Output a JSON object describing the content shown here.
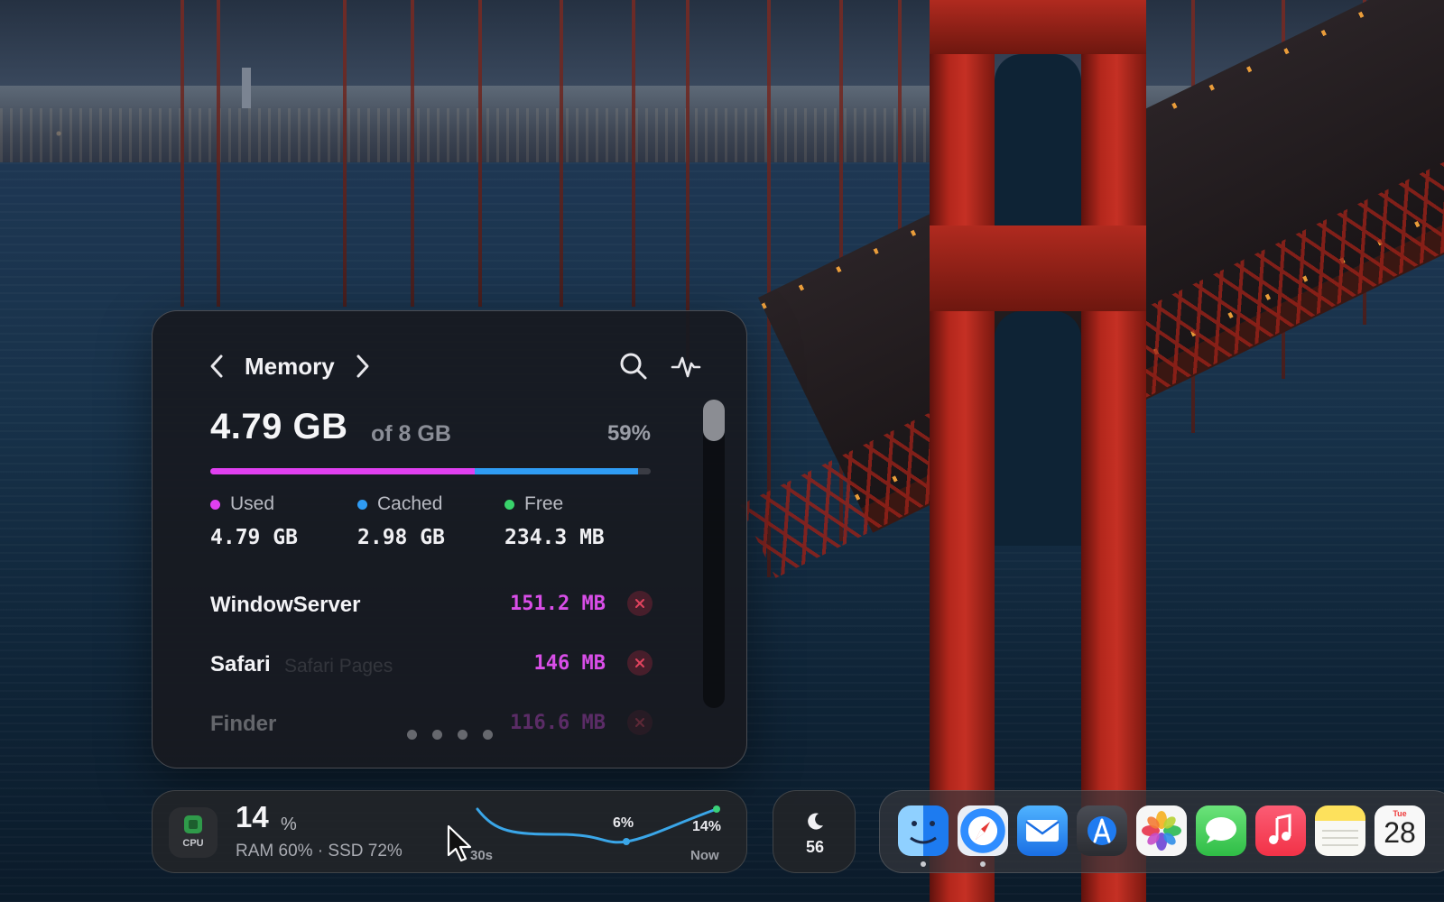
{
  "memory_widget": {
    "title": "Memory",
    "used_value": "4.79 GB",
    "total_text": "of 8 GB",
    "percent": "59%",
    "usage_bar": {
      "used_fraction": 0.6,
      "cached_fraction": 0.37,
      "used_color": "#e040f0",
      "cached_color": "#2f9cf4",
      "track_color": "#3a3c44"
    },
    "legend": [
      {
        "label": "Used",
        "value": "4.79 GB",
        "color": "#e040f0"
      },
      {
        "label": "Cached",
        "value": "2.98 GB",
        "color": "#2f9cf4"
      },
      {
        "label": "Free",
        "value": "234.3 MB",
        "color": "#39d36b"
      }
    ],
    "processes": [
      {
        "name": "WindowServer",
        "memory": "151.2 MB"
      },
      {
        "name": "Safari",
        "ghost": "Safari Pages",
        "memory": "146 MB"
      },
      {
        "name": "Finder",
        "memory": "116.6 MB"
      }
    ],
    "page_count": 4,
    "icons": {
      "prev": "chevron-left-icon",
      "next": "chevron-right-icon",
      "search": "search-icon",
      "activity": "activity-pulse-icon",
      "kill": "close-icon"
    }
  },
  "stats_widget": {
    "cpu_label": "CPU",
    "cpu_value": "14",
    "cpu_unit": "%",
    "ram_ssd": "RAM 60% · SSD 72%",
    "sparkline": {
      "label_low": "6%",
      "label_now": "14%",
      "time_start": "30s",
      "time_end": "Now",
      "line_color": "#3aa6e8",
      "end_color": "#3ad17a"
    }
  },
  "focus_widget": {
    "icon": "moon-icon",
    "value": "56"
  },
  "dock": {
    "apps": [
      "Finder",
      "Safari",
      "Mail",
      "Xcode",
      "Photos",
      "Messages",
      "Music",
      "Notes",
      "Calendar"
    ],
    "calendar": {
      "day": "Tue",
      "date": "28"
    }
  }
}
